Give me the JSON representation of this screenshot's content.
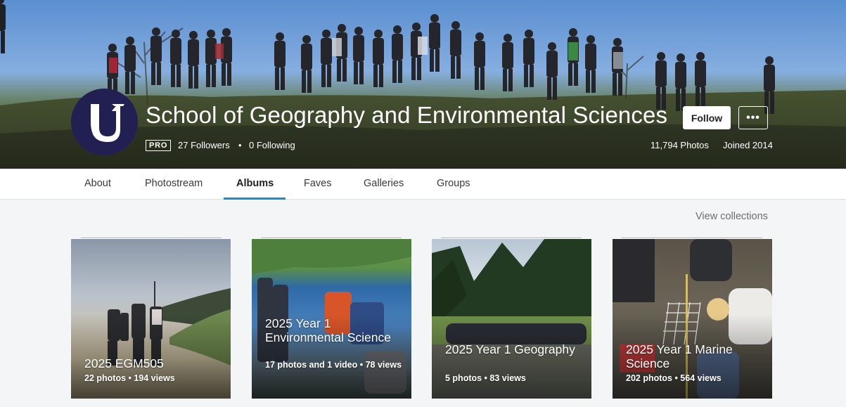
{
  "profile": {
    "name": "School of Geography and Environmental Sciences",
    "pro_label": "PRO",
    "followers": "27 Followers",
    "following": "0 Following",
    "separator": "•",
    "photos": "11,794 Photos",
    "joined": "Joined 2014",
    "follow_label": "Follow",
    "more_label": "•••"
  },
  "tabs": [
    {
      "label": "About"
    },
    {
      "label": "Photostream"
    },
    {
      "label": "Albums",
      "active": true
    },
    {
      "label": "Faves"
    },
    {
      "label": "Galleries"
    },
    {
      "label": "Groups"
    }
  ],
  "view_collections": "View collections",
  "albums": [
    {
      "title": "2025 EGM505",
      "stats": "22 photos  •  194 views"
    },
    {
      "title": "2025 Year 1 Environmental Science",
      "stats": "17 photos and 1 video  •  78 views"
    },
    {
      "title": "2025 Year 1 Geography",
      "stats": "5 photos  •  83 views"
    },
    {
      "title": "2025 Year 1 Marine Science",
      "stats": "202 photos  •  564 views"
    }
  ],
  "colors": {
    "accent": "#128fdc",
    "avatar_bg": "#221f52"
  }
}
